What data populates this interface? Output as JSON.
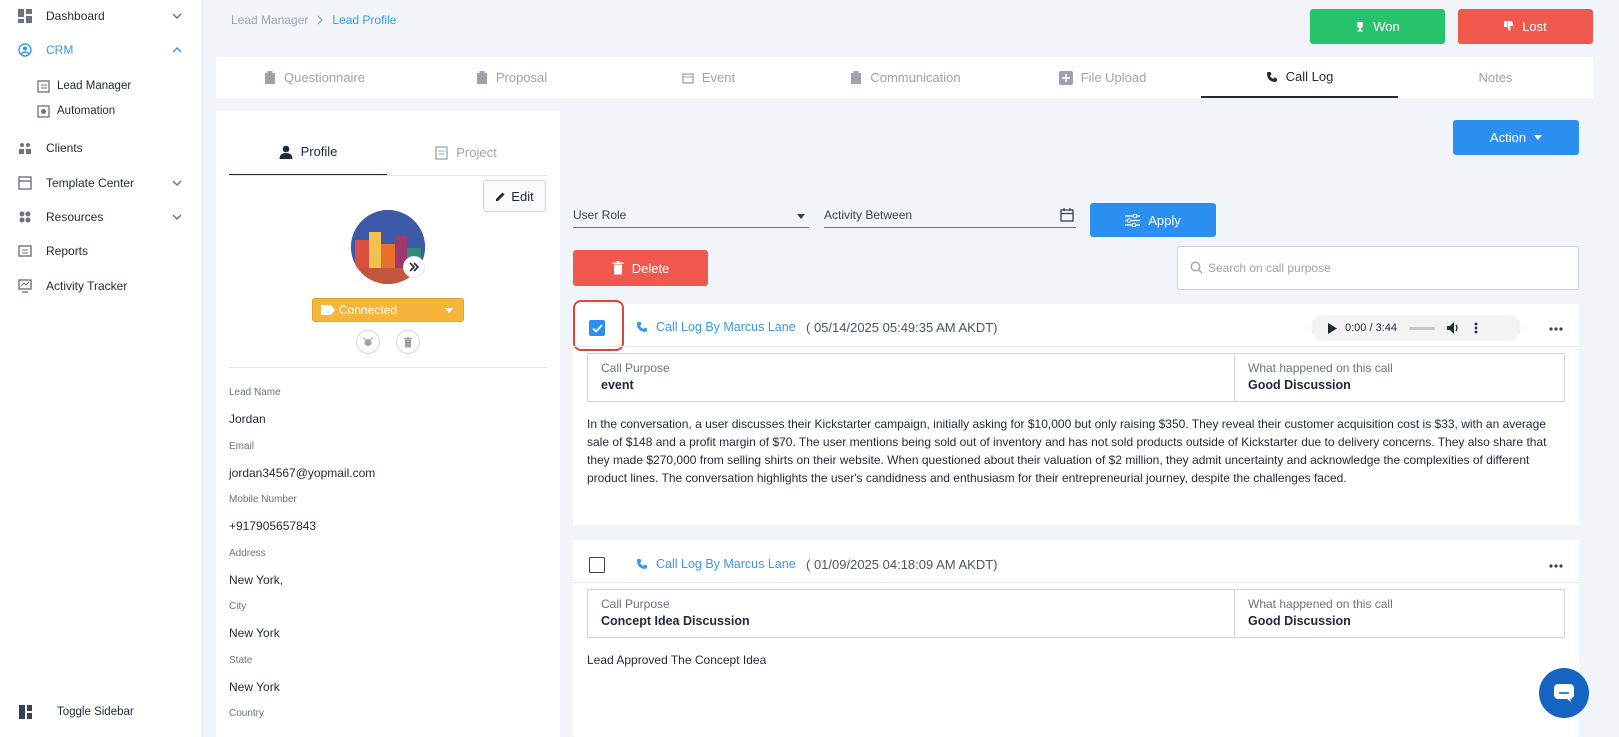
{
  "sidebar": {
    "items": [
      {
        "label": "Dashboard",
        "icon": "dashboard-icon"
      },
      {
        "label": "CRM",
        "icon": "crm-icon"
      },
      {
        "label": "Lead Manager",
        "icon": "lead-manager-icon"
      },
      {
        "label": "Automation",
        "icon": "automation-icon"
      },
      {
        "label": "Clients",
        "icon": "clients-icon"
      },
      {
        "label": "Template Center",
        "icon": "template-icon"
      },
      {
        "label": "Resources",
        "icon": "resources-icon"
      },
      {
        "label": "Reports",
        "icon": "reports-icon"
      },
      {
        "label": "Activity Tracker",
        "icon": "activity-icon"
      }
    ],
    "toggle_label": "Toggle Sidebar",
    "accent_color": "#3b97e3"
  },
  "breadcrumb": {
    "parent": "Lead Manager",
    "current": "Lead Profile"
  },
  "header": {
    "won_label": "Won",
    "lost_label": "Lost"
  },
  "tabs": [
    {
      "label": "Questionnaire"
    },
    {
      "label": "Proposal"
    },
    {
      "label": "Event"
    },
    {
      "label": "Communication"
    },
    {
      "label": "File Upload"
    },
    {
      "label": "Call Log"
    },
    {
      "label": "Notes"
    }
  ],
  "profile": {
    "tab_profile": "Profile",
    "tab_project": "Project",
    "edit_label": "Edit",
    "status": "Connected",
    "fields": [
      {
        "label": "Lead Name",
        "value": "Jordan"
      },
      {
        "label": "Email",
        "value": "jordan34567@yopmail.com"
      },
      {
        "label": "Mobile Number",
        "value": "+917905657843"
      },
      {
        "label": "Address",
        "value": "New York,"
      },
      {
        "label": "City",
        "value": "New York"
      },
      {
        "label": "State",
        "value": "New York"
      },
      {
        "label": "Country",
        "value": ""
      }
    ]
  },
  "calllog": {
    "action_label": "Action",
    "user_role_label": "User Role",
    "activity_between_label": "Activity Between",
    "apply_label": "Apply",
    "delete_label": "Delete",
    "search_placeholder": "Search on call purpose",
    "entries": [
      {
        "title": "Call Log By Marcus Lane",
        "date": "(  05/14/2025 05:49:35 AM AKDT)",
        "checked": true,
        "audio_time": "0:00 / 3:44",
        "purpose_label": "Call Purpose",
        "purpose": "event",
        "happened_label": "What happened on this call",
        "happened": "Good Discussion",
        "summary": "In the conversation, a user discusses their Kickstarter campaign, initially asking for $10,000 but only raising $350. They reveal their customer acquisition cost is $33, with an average sale of $148 and a profit margin of $70. The user mentions being sold out of inventory and has not sold products outside of Kickstarter due to delivery concerns. They also share that they made $270,000 from selling shirts on their website. When questioned about their valuation of $2 million, they admit uncertainty and acknowledge the complexities of different product lines. The conversation highlights the user's candidness and enthusiasm for their entrepreneurial journey, despite the challenges faced."
      },
      {
        "title": "Call Log By Marcus Lane",
        "date": "(  01/09/2025 04:18:09 AM AKDT)",
        "checked": false,
        "purpose_label": "Call Purpose",
        "purpose": "Concept Idea Discussion",
        "happened_label": "What happened on this call",
        "happened": "Good Discussion",
        "summary": "Lead Approved The Concept Idea"
      }
    ]
  }
}
